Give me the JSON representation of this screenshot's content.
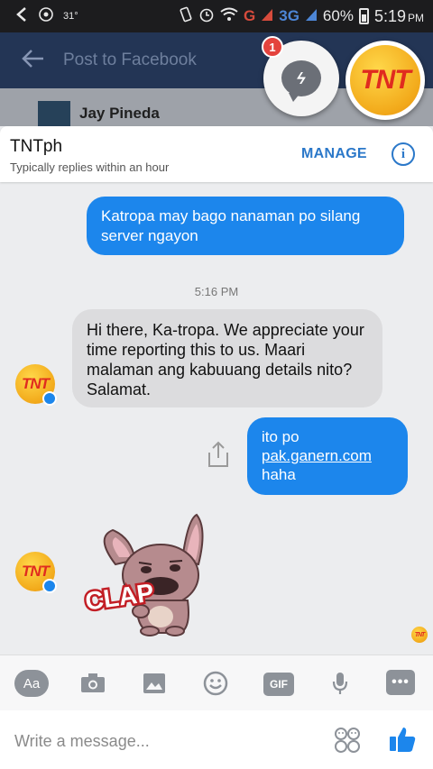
{
  "status_bar": {
    "temperature": "31°",
    "network_g": "G",
    "network_3g": "3G",
    "battery": "60%",
    "time": "5:19",
    "ampm": "PM"
  },
  "background_app": {
    "title": "Post to Facebook",
    "user_name": "Jay Pineda"
  },
  "chat_heads": {
    "unread_count": "1",
    "active_page_logo": "TNT"
  },
  "chat": {
    "page_name": "TNTph",
    "response_time": "Typically replies within an hour",
    "manage_label": "MANAGE",
    "info_icon": "i"
  },
  "messages": [
    {
      "from": "me",
      "text": "Katropa may bago nanaman po silang server ngayon"
    },
    {
      "from": "page",
      "text": "Hi there, Ka-tropa. We appreciate your time reporting this to us. Maari malaman ang kabuuang details nito? Salamat."
    },
    {
      "from": "me",
      "line1": "ito po",
      "link": "pak.ganern.com",
      "line3": "haha"
    }
  ],
  "timestamp": "5:16 PM",
  "avatar_logo": "TNT",
  "sticker": {
    "text": "CLAP"
  },
  "toolbar": {
    "aa_label": "Aa",
    "gif_label": "GIF",
    "more_label": "•••"
  },
  "compose": {
    "placeholder": "Write a message...",
    "value": ""
  },
  "colors": {
    "outgoing_bubble": "#1c86ec",
    "incoming_bubble": "#dcdcde",
    "accent": "#2b78c9"
  }
}
